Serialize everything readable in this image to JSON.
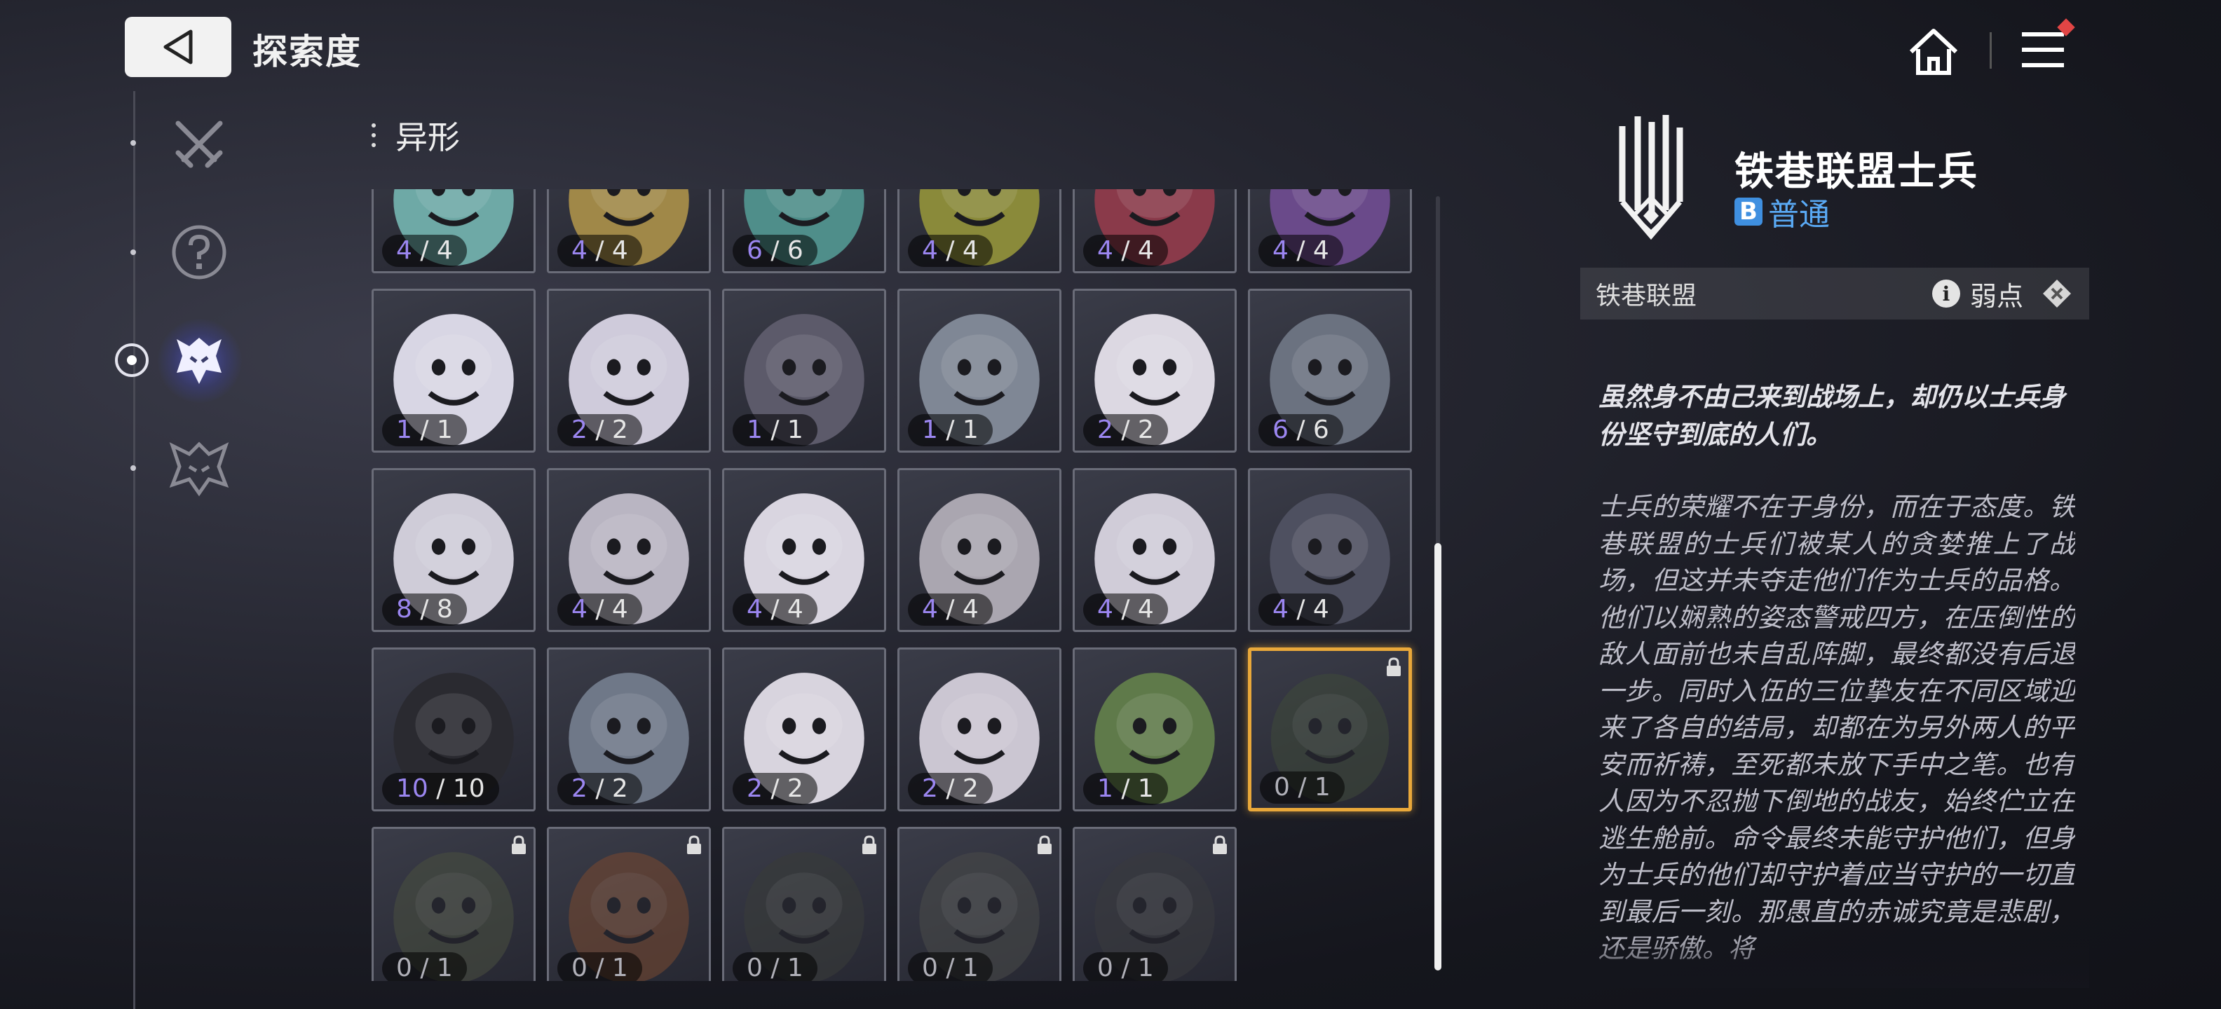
{
  "header": {
    "title": "探索度",
    "back_icon": "back-arrow-icon",
    "home_icon": "home-icon",
    "menu_icon": "menu-icon"
  },
  "sidebar": {
    "items": [
      {
        "name": "swords-icon",
        "active": false
      },
      {
        "name": "question-icon",
        "active": false
      },
      {
        "name": "alien-head-icon",
        "active": true
      },
      {
        "name": "crest-icon",
        "active": false
      }
    ]
  },
  "category": {
    "label": "异形"
  },
  "grid": {
    "cards": [
      {
        "cur": "4",
        "total": "4",
        "locked": false,
        "selected": false,
        "hue": "#6ea9a6"
      },
      {
        "cur": "4",
        "total": "4",
        "locked": false,
        "selected": false,
        "hue": "#a08848"
      },
      {
        "cur": "6",
        "total": "6",
        "locked": false,
        "selected": false,
        "hue": "#4f8e8a"
      },
      {
        "cur": "4",
        "total": "4",
        "locked": false,
        "selected": false,
        "hue": "#8a8a3a"
      },
      {
        "cur": "4",
        "total": "4",
        "locked": false,
        "selected": false,
        "hue": "#8a3a4a"
      },
      {
        "cur": "4",
        "total": "4",
        "locked": false,
        "selected": false,
        "hue": "#6a4a8a"
      },
      {
        "cur": "1",
        "total": "1",
        "locked": false,
        "selected": false,
        "hue": "#d8d6e4"
      },
      {
        "cur": "2",
        "total": "2",
        "locked": false,
        "selected": false,
        "hue": "#cfcbdb"
      },
      {
        "cur": "1",
        "total": "1",
        "locked": false,
        "selected": false,
        "hue": "#5c5a6a"
      },
      {
        "cur": "1",
        "total": "1",
        "locked": false,
        "selected": false,
        "hue": "#7f8795"
      },
      {
        "cur": "2",
        "total": "2",
        "locked": false,
        "selected": false,
        "hue": "#dcd8e2"
      },
      {
        "cur": "6",
        "total": "6",
        "locked": false,
        "selected": false,
        "hue": "#6b7280"
      },
      {
        "cur": "8",
        "total": "8",
        "locked": false,
        "selected": false,
        "hue": "#cfccd8"
      },
      {
        "cur": "4",
        "total": "4",
        "locked": false,
        "selected": false,
        "hue": "#b9b5c2"
      },
      {
        "cur": "4",
        "total": "4",
        "locked": false,
        "selected": false,
        "hue": "#d9d5e0"
      },
      {
        "cur": "4",
        "total": "4",
        "locked": false,
        "selected": false,
        "hue": "#aaa6b0"
      },
      {
        "cur": "4",
        "total": "4",
        "locked": false,
        "selected": false,
        "hue": "#d0ccd8"
      },
      {
        "cur": "4",
        "total": "4",
        "locked": false,
        "selected": false,
        "hue": "#4e5060"
      },
      {
        "cur": "10",
        "total": "10",
        "locked": false,
        "selected": false,
        "hue": "#2a2a30"
      },
      {
        "cur": "2",
        "total": "2",
        "locked": false,
        "selected": false,
        "hue": "#6f7888"
      },
      {
        "cur": "2",
        "total": "2",
        "locked": false,
        "selected": false,
        "hue": "#d8d4de"
      },
      {
        "cur": "2",
        "total": "2",
        "locked": false,
        "selected": false,
        "hue": "#cbc6d2"
      },
      {
        "cur": "1",
        "total": "1",
        "locked": false,
        "selected": false,
        "hue": "#5f7a4a"
      },
      {
        "cur": "0",
        "total": "1",
        "locked": true,
        "selected": true,
        "hue": "#3f4a3a"
      },
      {
        "cur": "0",
        "total": "1",
        "locked": true,
        "selected": false,
        "hue": "#4a5040"
      },
      {
        "cur": "0",
        "total": "1",
        "locked": true,
        "selected": false,
        "hue": "#7a4a30"
      },
      {
        "cur": "0",
        "total": "1",
        "locked": true,
        "selected": false,
        "hue": "#3a3d3a"
      },
      {
        "cur": "0",
        "total": "1",
        "locked": true,
        "selected": false,
        "hue": "#4a4c4a"
      },
      {
        "cur": "0",
        "total": "1",
        "locked": true,
        "selected": false,
        "hue": "#3a3b3e"
      }
    ]
  },
  "detail": {
    "name": "铁巷联盟士兵",
    "rank_letter": "B",
    "rank_label": "普通",
    "faction": "铁巷联盟",
    "weakness_label": "弱点",
    "quote": "虽然身不由己来到战场上，却仍以士兵身份坚守到底的人们。",
    "description": "士兵的荣耀不在于身份，而在于态度。铁巷联盟的士兵们被某人的贪婪推上了战场，但这并未夺走他们作为士兵的品格。他们以娴熟的姿态警戒四方，在压倒性的敌人面前也未自乱阵脚，最终都没有后退一步。同时入伍的三位挚友在不同区域迎来了各自的结局，却都在为另外两人的平安而祈祷，至死都未放下手中之笔。也有人因为不忍抛下倒地的战友，始终伫立在逃生舱前。命令最终未能守护他们，但身为士兵的他们却守护着应当守护的一切直到最后一刻。那愚直的赤诚究竟是悲剧，还是骄傲。将"
  },
  "colors": {
    "accent": "#9b86f0",
    "selected_border": "#e9a83a",
    "rank": "#3f8fe0",
    "notification": "#e14545"
  }
}
